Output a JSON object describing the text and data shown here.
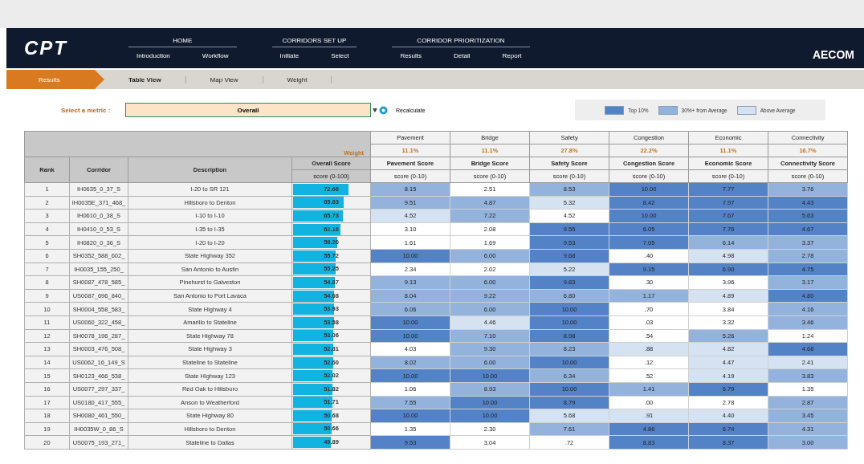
{
  "app": {
    "logo": "CPT",
    "brand": "AECOM"
  },
  "nav": [
    {
      "label": "HOME",
      "items": [
        {
          "label": "Introduction"
        },
        {
          "label": "Workflow"
        }
      ]
    },
    {
      "label": "CORRIDORS SET UP",
      "items": [
        {
          "label": "Initiate"
        },
        {
          "label": "Select"
        }
      ]
    },
    {
      "label": "CORRIDOR PRIORITIZATION",
      "items": [
        {
          "label": "Results"
        },
        {
          "label": "Detail"
        },
        {
          "label": "Report"
        }
      ]
    }
  ],
  "subnav": {
    "current": "Results",
    "tabs": [
      {
        "label": "Table View",
        "selected": true
      },
      {
        "label": "Map View",
        "selected": false
      },
      {
        "label": "Weight",
        "selected": false
      }
    ]
  },
  "metric": {
    "label": "Select a metric :",
    "value": "Overall",
    "button": "Recalculate"
  },
  "legend": [
    {
      "label": "Top 10%",
      "kind": "top"
    },
    {
      "label": "30%+ from Average",
      "kind": "high"
    },
    {
      "label": "Above Average",
      "kind": "above"
    }
  ],
  "table": {
    "weight_label": "Weight",
    "rank": "Rank",
    "corridor": "Corridor",
    "description": "Description",
    "overall": "Overall Score",
    "overall_unit": "score (0-100)",
    "categories": [
      {
        "name": "Pavement",
        "weight": "11.1%",
        "score": "Pavement Score",
        "unit": "score (0-10)"
      },
      {
        "name": "Bridge",
        "weight": "11.1%",
        "score": "Bridge Score",
        "unit": "score (0-10)"
      },
      {
        "name": "Safety",
        "weight": "27.8%",
        "score": "Safety Score",
        "unit": "score (0-10)"
      },
      {
        "name": "Congestion",
        "weight": "22.2%",
        "score": "Congestion Score",
        "unit": "score (0-10)"
      },
      {
        "name": "Economic",
        "weight": "11.1%",
        "score": "Economic Score",
        "unit": "score (0-10)"
      },
      {
        "name": "Connectivity",
        "weight": "16.7%",
        "score": "Connectivity Score",
        "unit": "score (0-10)"
      }
    ],
    "rows": [
      {
        "rank": "1",
        "corridor": "IH0635_0_37_S",
        "description": "I-20 to SR 121",
        "overall": "72.66",
        "level": 0.7266,
        "scores": [
          {
            "value": "8.15",
            "kind": "high"
          },
          {
            "value": "2.51",
            "kind": "none"
          },
          {
            "value": "8.53",
            "kind": "high"
          },
          {
            "value": "10.00",
            "kind": "top"
          },
          {
            "value": "7.77",
            "kind": "top"
          },
          {
            "value": "3.76",
            "kind": "high"
          }
        ]
      },
      {
        "rank": "2",
        "corridor": "IH0035E_371_468_",
        "description": "Hillsboro to Denton",
        "overall": "65.83",
        "level": 0.6583,
        "scores": [
          {
            "value": "9.51",
            "kind": "high"
          },
          {
            "value": "4.87",
            "kind": "high"
          },
          {
            "value": "5.32",
            "kind": "above"
          },
          {
            "value": "8.42",
            "kind": "top"
          },
          {
            "value": "7.97",
            "kind": "top"
          },
          {
            "value": "4.43",
            "kind": "top"
          }
        ]
      },
      {
        "rank": "3",
        "corridor": "IH0610_0_38_S",
        "description": "I-10 to I-10",
        "overall": "65.73",
        "level": 0.6573,
        "scores": [
          {
            "value": "4.52",
            "kind": "above"
          },
          {
            "value": "7.22",
            "kind": "high"
          },
          {
            "value": "4.52",
            "kind": "none"
          },
          {
            "value": "10.00",
            "kind": "top"
          },
          {
            "value": "7.67",
            "kind": "top"
          },
          {
            "value": "5.63",
            "kind": "top"
          }
        ]
      },
      {
        "rank": "4",
        "corridor": "IH0410_0_53_S",
        "description": "I-35 to I-35",
        "overall": "62.16",
        "level": 0.6216,
        "scores": [
          {
            "value": "3.10",
            "kind": "none"
          },
          {
            "value": "2.08",
            "kind": "none"
          },
          {
            "value": "9.55",
            "kind": "top"
          },
          {
            "value": "6.05",
            "kind": "top"
          },
          {
            "value": "7.76",
            "kind": "top"
          },
          {
            "value": "4.67",
            "kind": "top"
          }
        ]
      },
      {
        "rank": "5",
        "corridor": "IH0820_0_36_S",
        "description": "I-20 to I-20",
        "overall": "58.20",
        "level": 0.582,
        "scores": [
          {
            "value": "1.61",
            "kind": "none"
          },
          {
            "value": "1.69",
            "kind": "none"
          },
          {
            "value": "9.53",
            "kind": "top"
          },
          {
            "value": "7.05",
            "kind": "top"
          },
          {
            "value": "6.14",
            "kind": "high"
          },
          {
            "value": "3.37",
            "kind": "high"
          }
        ]
      },
      {
        "rank": "6",
        "corridor": "SH0352_588_602_",
        "description": "State Highway 352",
        "overall": "55.72",
        "level": 0.5572,
        "scores": [
          {
            "value": "10.00",
            "kind": "top"
          },
          {
            "value": "6.00",
            "kind": "high"
          },
          {
            "value": "9.68",
            "kind": "top"
          },
          {
            "value": ".40",
            "kind": "none"
          },
          {
            "value": "4.98",
            "kind": "above"
          },
          {
            "value": "2.78",
            "kind": "high"
          }
        ]
      },
      {
        "rank": "7",
        "corridor": "IH0035_155_250_",
        "description": "San Antonio to Austin",
        "overall": "55.25",
        "level": 0.5525,
        "scores": [
          {
            "value": "2.34",
            "kind": "none"
          },
          {
            "value": "2.02",
            "kind": "none"
          },
          {
            "value": "5.22",
            "kind": "above"
          },
          {
            "value": "9.15",
            "kind": "top"
          },
          {
            "value": "6.90",
            "kind": "top"
          },
          {
            "value": "4.75",
            "kind": "top"
          }
        ]
      },
      {
        "rank": "8",
        "corridor": "SH0087_478_585_",
        "description": "Pinehurst to Galveston",
        "overall": "54.87",
        "level": 0.5487,
        "scores": [
          {
            "value": "9.13",
            "kind": "high"
          },
          {
            "value": "6.00",
            "kind": "high"
          },
          {
            "value": "9.83",
            "kind": "top"
          },
          {
            "value": ".30",
            "kind": "none"
          },
          {
            "value": "3.96",
            "kind": "none"
          },
          {
            "value": "3.17",
            "kind": "high"
          }
        ]
      },
      {
        "rank": "9",
        "corridor": "US0087_696_840_",
        "description": "San Antonio to Port Lavaca",
        "overall": "54.08",
        "level": 0.5408,
        "scores": [
          {
            "value": "8.04",
            "kind": "high"
          },
          {
            "value": "9.22",
            "kind": "high"
          },
          {
            "value": "6.80",
            "kind": "high"
          },
          {
            "value": "1.17",
            "kind": "high"
          },
          {
            "value": "4.89",
            "kind": "above"
          },
          {
            "value": "4.80",
            "kind": "top"
          }
        ]
      },
      {
        "rank": "10",
        "corridor": "SH0004_558_583_",
        "description": "State Highway 4",
        "overall": "53.93",
        "level": 0.5393,
        "scores": [
          {
            "value": "6.06",
            "kind": "high"
          },
          {
            "value": "6.00",
            "kind": "high"
          },
          {
            "value": "10.00",
            "kind": "top"
          },
          {
            "value": ".70",
            "kind": "none"
          },
          {
            "value": "3.84",
            "kind": "none"
          },
          {
            "value": "4.16",
            "kind": "high"
          }
        ]
      },
      {
        "rank": "11",
        "corridor": "US0060_322_458_",
        "description": "Amarillo to Stateline",
        "overall": "53.58",
        "level": 0.5358,
        "scores": [
          {
            "value": "10.00",
            "kind": "top"
          },
          {
            "value": "4.46",
            "kind": "above"
          },
          {
            "value": "10.00",
            "kind": "top"
          },
          {
            "value": ".03",
            "kind": "none"
          },
          {
            "value": "3.32",
            "kind": "none"
          },
          {
            "value": "3.46",
            "kind": "high"
          }
        ]
      },
      {
        "rank": "12",
        "corridor": "SH0078_196_287_",
        "description": "State Highway 78",
        "overall": "53.06",
        "level": 0.5306,
        "scores": [
          {
            "value": "10.00",
            "kind": "top"
          },
          {
            "value": "7.10",
            "kind": "high"
          },
          {
            "value": "8.98",
            "kind": "top"
          },
          {
            "value": ".54",
            "kind": "none"
          },
          {
            "value": "5.26",
            "kind": "high"
          },
          {
            "value": "1.24",
            "kind": "none"
          }
        ]
      },
      {
        "rank": "13",
        "corridor": "SH0003_476_508_",
        "description": "State Highway 3",
        "overall": "52.81",
        "level": 0.5281,
        "scores": [
          {
            "value": "4.03",
            "kind": "none"
          },
          {
            "value": "9.30",
            "kind": "high"
          },
          {
            "value": "8.23",
            "kind": "high"
          },
          {
            "value": ".88",
            "kind": "above"
          },
          {
            "value": "4.82",
            "kind": "above"
          },
          {
            "value": "4.68",
            "kind": "top"
          }
        ]
      },
      {
        "rank": "14",
        "corridor": "US0062_16_149_S",
        "description": "Stateline to Stateline",
        "overall": "52.60",
        "level": 0.526,
        "scores": [
          {
            "value": "8.02",
            "kind": "high"
          },
          {
            "value": "6.00",
            "kind": "high"
          },
          {
            "value": "10.00",
            "kind": "top"
          },
          {
            "value": ".12",
            "kind": "none"
          },
          {
            "value": "4.47",
            "kind": "above"
          },
          {
            "value": "2.41",
            "kind": "above"
          }
        ]
      },
      {
        "rank": "15",
        "corridor": "SH0123_466_538_",
        "description": "State Highway 123",
        "overall": "52.02",
        "level": 0.5202,
        "scores": [
          {
            "value": "10.00",
            "kind": "top"
          },
          {
            "value": "10.00",
            "kind": "top"
          },
          {
            "value": "6.34",
            "kind": "high"
          },
          {
            "value": ".52",
            "kind": "none"
          },
          {
            "value": "4.19",
            "kind": "above"
          },
          {
            "value": "3.83",
            "kind": "high"
          }
        ]
      },
      {
        "rank": "16",
        "corridor": "US0077_297_337_",
        "description": "Red Oak to Hillsboro",
        "overall": "51.82",
        "level": 0.5182,
        "scores": [
          {
            "value": "1.06",
            "kind": "none"
          },
          {
            "value": "8.93",
            "kind": "high"
          },
          {
            "value": "10.00",
            "kind": "top"
          },
          {
            "value": "1.41",
            "kind": "high"
          },
          {
            "value": "6.79",
            "kind": "top"
          },
          {
            "value": "1.35",
            "kind": "none"
          }
        ]
      },
      {
        "rank": "17",
        "corridor": "US0180_417_555_",
        "description": "Anson to Weatherford",
        "overall": "51.71",
        "level": 0.5171,
        "scores": [
          {
            "value": "7.55",
            "kind": "high"
          },
          {
            "value": "10.00",
            "kind": "top"
          },
          {
            "value": "8.79",
            "kind": "top"
          },
          {
            "value": ".00",
            "kind": "none"
          },
          {
            "value": "2.78",
            "kind": "none"
          },
          {
            "value": "2.87",
            "kind": "high"
          }
        ]
      },
      {
        "rank": "18",
        "corridor": "SH0080_461_550_",
        "description": "State Highway 80",
        "overall": "50.68",
        "level": 0.5068,
        "scores": [
          {
            "value": "10.00",
            "kind": "top"
          },
          {
            "value": "10.00",
            "kind": "top"
          },
          {
            "value": "5.68",
            "kind": "above"
          },
          {
            "value": ".91",
            "kind": "above"
          },
          {
            "value": "4.40",
            "kind": "above"
          },
          {
            "value": "3.45",
            "kind": "high"
          }
        ]
      },
      {
        "rank": "19",
        "corridor": "IH0035W_0_86_S",
        "description": "Hillsboro to Denton",
        "overall": "50.66",
        "level": 0.5066,
        "scores": [
          {
            "value": "1.35",
            "kind": "none"
          },
          {
            "value": "2.30",
            "kind": "none"
          },
          {
            "value": "7.61",
            "kind": "high"
          },
          {
            "value": "4.86",
            "kind": "top"
          },
          {
            "value": "6.74",
            "kind": "top"
          },
          {
            "value": "4.31",
            "kind": "high"
          }
        ]
      },
      {
        "rank": "20",
        "corridor": "US0075_193_271_",
        "description": "Stateline to Dallas",
        "overall": "49.89",
        "level": 0.4989,
        "scores": [
          {
            "value": "9.53",
            "kind": "top"
          },
          {
            "value": "3.04",
            "kind": "none"
          },
          {
            "value": ".72",
            "kind": "none"
          },
          {
            "value": "8.83",
            "kind": "top"
          },
          {
            "value": "8.37",
            "kind": "top"
          },
          {
            "value": "3.00",
            "kind": "high"
          }
        ]
      }
    ]
  }
}
